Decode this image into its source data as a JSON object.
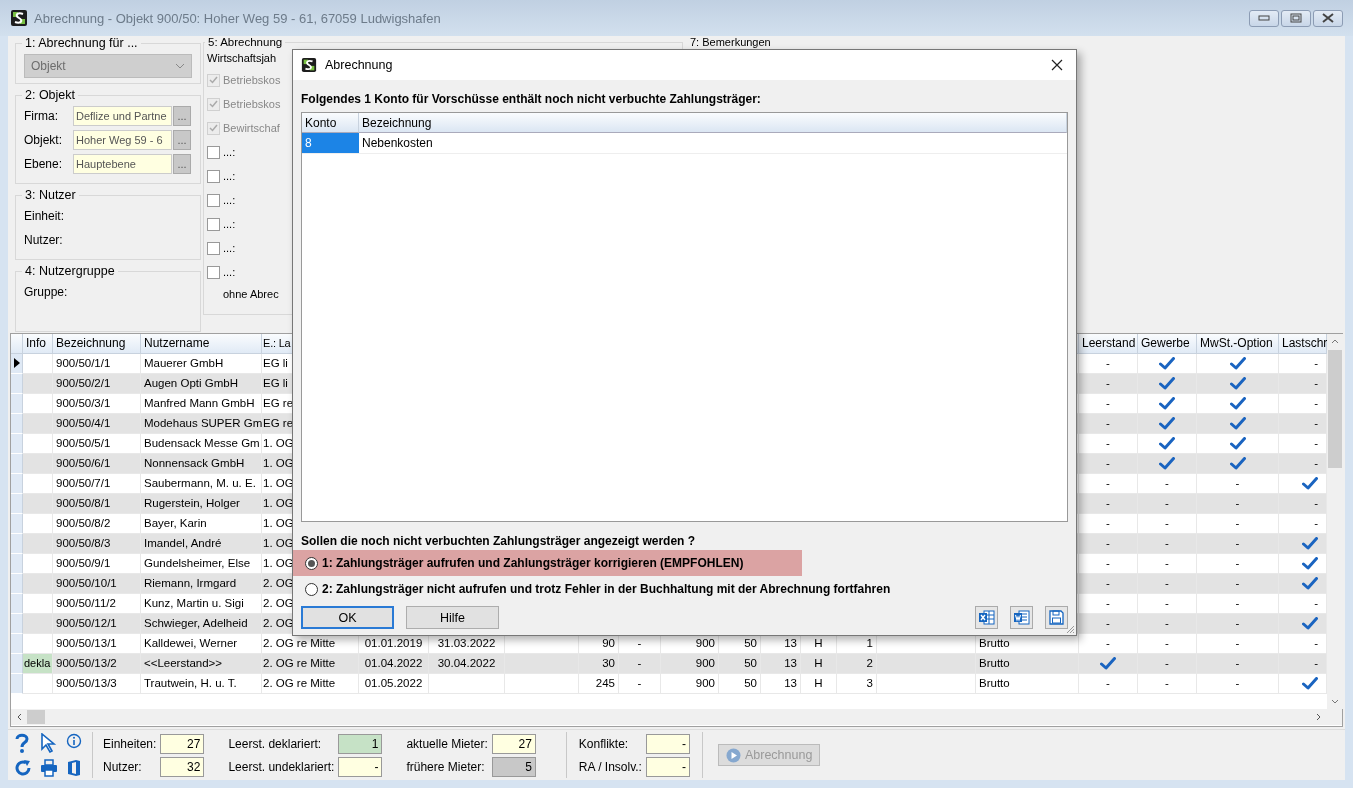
{
  "window": {
    "title": "Abrechnung - Objekt 900/50:  Hoher Weg 59 - 61, 67059 Ludwigshafen"
  },
  "group_1": {
    "title": "1: Abrechnung für ...",
    "combo": {
      "value": "Objekt",
      "disabled": true
    }
  },
  "group_2": {
    "title": "2: Objekt",
    "fields": [
      {
        "label": "Firma:",
        "value": "Deflize und Partne",
        "button": "..."
      },
      {
        "label": "Objekt:",
        "value": "Hoher Weg 59 - 6",
        "button": "..."
      },
      {
        "label": "Ebene:",
        "value": "Hauptebene",
        "button": "..."
      }
    ]
  },
  "group_3": {
    "title": "3: Nutzer",
    "labels": [
      "Einheit:",
      "Nutzer:"
    ]
  },
  "group_4": {
    "title": "4: Nutzergruppe",
    "labels": [
      "Gruppe:"
    ]
  },
  "group_5": {
    "title": "5: Abrechnung",
    "label": "Wirtschaftsjah",
    "options": [
      {
        "label": "Betriebskos",
        "checked": true,
        "disabled": true
      },
      {
        "label": "Betriebskos",
        "checked": true,
        "disabled": true
      },
      {
        "label": "Bewirtschaf",
        "checked": true,
        "disabled": true
      },
      {
        "label": "...:",
        "checked": false,
        "disabled": false
      },
      {
        "label": "...:",
        "checked": false,
        "disabled": false
      },
      {
        "label": "...:",
        "checked": false,
        "disabled": false
      },
      {
        "label": "...:",
        "checked": false,
        "disabled": false
      },
      {
        "label": "...:",
        "checked": false,
        "disabled": false
      },
      {
        "label": "...:",
        "checked": false,
        "disabled": false
      }
    ],
    "footer": "ohne Abrec"
  },
  "group_7": {
    "title": "7: Bemerkungen"
  },
  "table": {
    "columns": {
      "info": "Info",
      "bezeichnung": "Bezeichnung",
      "nutzername": "Nutzername",
      "lage": "E.: La",
      "leerstand": "Leerstand",
      "gewerbe": "Gewerbe",
      "mwst_option": "MwSt.-Option",
      "lastschrift": "Lastschr"
    },
    "rows": [
      {
        "selected": true,
        "bezeichnung": "900/50/1/1",
        "nutzername": "Mauerer GmbH",
        "lage": "EG li",
        "leerstand": {
          "checked": false,
          "text": "-"
        },
        "gewerbe": {
          "checked": true
        },
        "mwst_option": {
          "checked": true
        },
        "lastschrift": {
          "checked": false,
          "text": "-"
        }
      },
      {
        "selected": false,
        "bezeichnung": "900/50/2/1",
        "nutzername": "Augen Opti GmbH",
        "lage": "EG li",
        "leerstand": {
          "checked": false,
          "text": "-"
        },
        "gewerbe": {
          "checked": true
        },
        "mwst_option": {
          "checked": true
        },
        "lastschrift": {
          "checked": false,
          "text": "-"
        }
      },
      {
        "selected": false,
        "bezeichnung": "900/50/3/1",
        "nutzername": "Manfred Mann GmbH",
        "lage": "EG re",
        "leerstand": {
          "checked": false,
          "text": "-"
        },
        "gewerbe": {
          "checked": true
        },
        "mwst_option": {
          "checked": true
        },
        "lastschrift": {
          "checked": false,
          "text": "-"
        }
      },
      {
        "selected": false,
        "bezeichnung": "900/50/4/1",
        "nutzername": "Modehaus SUPER Gm",
        "lage": "EG re",
        "leerstand": {
          "checked": false,
          "text": "-"
        },
        "gewerbe": {
          "checked": true
        },
        "mwst_option": {
          "checked": true
        },
        "lastschrift": {
          "checked": false,
          "text": "-"
        }
      },
      {
        "selected": false,
        "bezeichnung": "900/50/5/1",
        "nutzername": "Budensack Messe Gm",
        "lage": "1. OG",
        "leerstand": {
          "checked": false,
          "text": "-"
        },
        "gewerbe": {
          "checked": true
        },
        "mwst_option": {
          "checked": true
        },
        "lastschrift": {
          "checked": false,
          "text": "-"
        }
      },
      {
        "selected": false,
        "bezeichnung": "900/50/6/1",
        "nutzername": "Nonnensack GmbH",
        "lage": "1. OG",
        "leerstand": {
          "checked": false,
          "text": "-"
        },
        "gewerbe": {
          "checked": true
        },
        "mwst_option": {
          "checked": true
        },
        "lastschrift": {
          "checked": false,
          "text": "-"
        }
      },
      {
        "selected": false,
        "bezeichnung": "900/50/7/1",
        "nutzername": "Saubermann, M. u. E.",
        "lage": "1. OG",
        "leerstand": {
          "checked": false,
          "text": "-"
        },
        "gewerbe": {
          "checked": false,
          "text": "-"
        },
        "mwst_option": {
          "checked": false,
          "text": "-"
        },
        "lastschrift": {
          "checked": true
        }
      },
      {
        "selected": false,
        "bezeichnung": "900/50/8/1",
        "nutzername": "Rugerstein, Holger",
        "lage": "1. OG",
        "leerstand": {
          "checked": false,
          "text": "-"
        },
        "gewerbe": {
          "checked": false,
          "text": "-"
        },
        "mwst_option": {
          "checked": false,
          "text": "-"
        },
        "lastschrift": {
          "checked": false,
          "text": "-"
        }
      },
      {
        "selected": false,
        "bezeichnung": "900/50/8/2",
        "nutzername": "Bayer, Karin",
        "lage": "1. OG",
        "leerstand": {
          "checked": false,
          "text": "-"
        },
        "gewerbe": {
          "checked": false,
          "text": "-"
        },
        "mwst_option": {
          "checked": false,
          "text": "-"
        },
        "lastschrift": {
          "checked": false,
          "text": "-"
        }
      },
      {
        "selected": false,
        "bezeichnung": "900/50/8/3",
        "nutzername": "Imandel, André",
        "lage": "1. OG",
        "leerstand": {
          "checked": false,
          "text": "-"
        },
        "gewerbe": {
          "checked": false,
          "text": "-"
        },
        "mwst_option": {
          "checked": false,
          "text": "-"
        },
        "lastschrift": {
          "checked": true
        }
      },
      {
        "selected": false,
        "bezeichnung": "900/50/9/1",
        "nutzername": "Gundelsheimer, Else",
        "lage": "1. OG",
        "leerstand": {
          "checked": false,
          "text": "-"
        },
        "gewerbe": {
          "checked": false,
          "text": "-"
        },
        "mwst_option": {
          "checked": false,
          "text": "-"
        },
        "lastschrift": {
          "checked": true
        }
      },
      {
        "selected": false,
        "bezeichnung": "900/50/10/1",
        "nutzername": "Riemann, Irmgard",
        "lage": "2. OG",
        "leerstand": {
          "checked": false,
          "text": "-"
        },
        "gewerbe": {
          "checked": false,
          "text": "-"
        },
        "mwst_option": {
          "checked": false,
          "text": "-"
        },
        "lastschrift": {
          "checked": true
        }
      },
      {
        "selected": false,
        "bezeichnung": "900/50/11/2",
        "nutzername": "Kunz, Martin u. Sigi",
        "lage": "2. OG",
        "leerstand": {
          "checked": false,
          "text": "-"
        },
        "gewerbe": {
          "checked": false,
          "text": "-"
        },
        "mwst_option": {
          "checked": false,
          "text": "-"
        },
        "lastschrift": {
          "checked": false,
          "text": "-"
        }
      },
      {
        "selected": false,
        "bezeichnung": "900/50/12/1",
        "nutzername": "Schwieger, Adelheid",
        "lage": "2. OG",
        "leerstand": {
          "checked": false,
          "text": "-"
        },
        "gewerbe": {
          "checked": false,
          "text": "-"
        },
        "mwst_option": {
          "checked": false,
          "text": "-"
        },
        "lastschrift": {
          "checked": true
        }
      },
      {
        "selected": false,
        "bezeichnung": "900/50/13/1",
        "nutzername": "Kalldewei, Werner",
        "lage": "2. OG re Mitte",
        "column_5": "01.01.2019",
        "column_6": "31.03.2022",
        "column_8": "90",
        "column_9": "-",
        "column_10": "900",
        "column_11": "50",
        "column_12": "13",
        "column_13": "H",
        "column_14": "1",
        "column_16": "Brutto",
        "leerstand": {
          "checked": false,
          "text": "-"
        },
        "gewerbe": {
          "checked": false,
          "text": "-"
        },
        "mwst_option": {
          "checked": false,
          "text": "-"
        },
        "lastschrift": {
          "checked": false,
          "text": "-"
        }
      },
      {
        "selected": false,
        "info": {
          "text": "dekla",
          "color": "#c6e2c6"
        },
        "bezeichnung": "900/50/13/2",
        "nutzername": "<<Leerstand>>",
        "lage": "2. OG re Mitte",
        "column_5": "01.04.2022",
        "column_6": "30.04.2022",
        "column_8": "30",
        "column_9": "-",
        "column_10": "900",
        "column_11": "50",
        "column_12": "13",
        "column_13": "H",
        "column_14": "2",
        "column_16": "Brutto",
        "leerstand": {
          "checked": true
        },
        "gewerbe": {
          "checked": false,
          "text": "-"
        },
        "mwst_option": {
          "checked": false,
          "text": "-"
        },
        "lastschrift": {
          "checked": false,
          "text": "-"
        }
      },
      {
        "selected": false,
        "bezeichnung": "900/50/13/3",
        "nutzername": "Trautwein, H. u. T.",
        "lage": "2. OG re Mitte",
        "column_5": "01.05.2022",
        "column_8": "245",
        "column_9": "-",
        "column_10": "900",
        "column_11": "50",
        "column_12": "13",
        "column_13": "H",
        "column_14": "3",
        "column_16": "Brutto",
        "leerstand": {
          "checked": false,
          "text": "-"
        },
        "gewerbe": {
          "checked": false,
          "text": "-"
        },
        "mwst_option": {
          "checked": false,
          "text": "-"
        },
        "lastschrift": {
          "checked": true
        }
      }
    ]
  },
  "status_bar": {
    "stats": [
      {
        "label": "Einheiten:",
        "value": "27",
        "color": "#ffffe1"
      },
      {
        "label": "Leerst. deklariert:",
        "value": "1",
        "color": "#c6e2c6"
      },
      {
        "label": "aktuelle Mieter:",
        "value": "27",
        "color": "#ffffe1"
      },
      {
        "label": "Nutzer:",
        "value": "32",
        "color": "#ffffe1"
      },
      {
        "label": "Leerst. undeklariert:",
        "value": "-",
        "color": "#ffffe1"
      },
      {
        "label": "frühere Mieter:",
        "value": "5",
        "color": "#c8c8c8"
      }
    ],
    "conflicts": [
      {
        "label": "Konflikte:",
        "value": "-"
      },
      {
        "label": "RA / Insolv.:",
        "value": "-"
      }
    ],
    "button": {
      "label": "Abrechnung",
      "disabled": true
    }
  },
  "dialog": {
    "title": "Abrechnung",
    "heading": "Folgendes 1 Konto für Vorschüsse enthält noch nicht verbuchte Zahlungsträger:",
    "list": {
      "columns": [
        "Konto",
        "Bezeichnung"
      ],
      "rows": [
        {
          "selected": true,
          "cells": [
            "8",
            "Nebenkosten"
          ]
        }
      ]
    },
    "question": "Sollen die noch nicht verbuchten Zahlungsträger angezeigt werden ?",
    "options": [
      {
        "label": "1: Zahlungsträger aufrufen und Zahlungsträger korrigieren (EMPFOHLEN)",
        "selected": true
      },
      {
        "label": "2: Zahlungsträger nicht aufrufen und trotz Fehler in der Buchhaltung mit der Abrechnung fortfahren",
        "selected": false
      }
    ],
    "buttons": [
      {
        "label": "OK",
        "default": true
      },
      {
        "label": "Hilfe",
        "default": false
      }
    ]
  }
}
